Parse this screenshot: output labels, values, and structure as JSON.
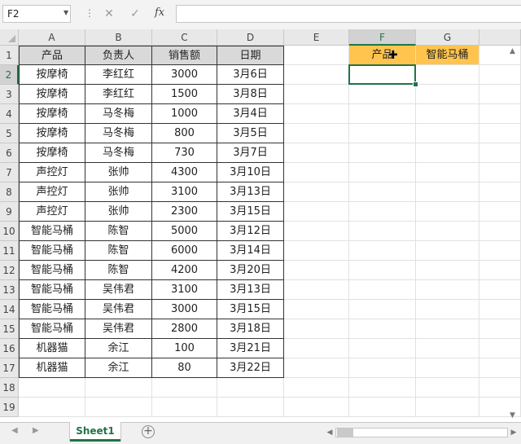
{
  "formula_bar": {
    "name_box": "F2",
    "cancel_icon": "✕",
    "enter_icon": "✓",
    "fx_label": "fx",
    "formula_value": ""
  },
  "columns": [
    "A",
    "B",
    "C",
    "D",
    "E",
    "F",
    "G"
  ],
  "selected_column": "F",
  "selected_row": 2,
  "rows": [
    {
      "row": "1",
      "cells": [
        "产品",
        "负责人",
        "销售额",
        "日期",
        "",
        "产品",
        "智能马桶"
      ]
    },
    {
      "row": "2",
      "cells": [
        "按摩椅",
        "李红红",
        "3000",
        "3月6日",
        "",
        "",
        ""
      ]
    },
    {
      "row": "3",
      "cells": [
        "按摩椅",
        "李红红",
        "1500",
        "3月8日",
        "",
        "",
        ""
      ]
    },
    {
      "row": "4",
      "cells": [
        "按摩椅",
        "马冬梅",
        "1000",
        "3月4日",
        "",
        "",
        ""
      ]
    },
    {
      "row": "5",
      "cells": [
        "按摩椅",
        "马冬梅",
        "800",
        "3月5日",
        "",
        "",
        ""
      ]
    },
    {
      "row": "6",
      "cells": [
        "按摩椅",
        "马冬梅",
        "730",
        "3月7日",
        "",
        "",
        ""
      ]
    },
    {
      "row": "7",
      "cells": [
        "声控灯",
        "张帅",
        "4300",
        "3月10日",
        "",
        "",
        ""
      ]
    },
    {
      "row": "8",
      "cells": [
        "声控灯",
        "张帅",
        "3100",
        "3月13日",
        "",
        "",
        ""
      ]
    },
    {
      "row": "9",
      "cells": [
        "声控灯",
        "张帅",
        "2300",
        "3月15日",
        "",
        "",
        ""
      ]
    },
    {
      "row": "10",
      "cells": [
        "智能马桶",
        "陈智",
        "5000",
        "3月12日",
        "",
        "",
        ""
      ]
    },
    {
      "row": "11",
      "cells": [
        "智能马桶",
        "陈智",
        "6000",
        "3月14日",
        "",
        "",
        ""
      ]
    },
    {
      "row": "12",
      "cells": [
        "智能马桶",
        "陈智",
        "4200",
        "3月20日",
        "",
        "",
        ""
      ]
    },
    {
      "row": "13",
      "cells": [
        "智能马桶",
        "吴伟君",
        "3100",
        "3月13日",
        "",
        "",
        ""
      ]
    },
    {
      "row": "14",
      "cells": [
        "智能马桶",
        "吴伟君",
        "3000",
        "3月15日",
        "",
        "",
        ""
      ]
    },
    {
      "row": "15",
      "cells": [
        "智能马桶",
        "吴伟君",
        "2800",
        "3月18日",
        "",
        "",
        ""
      ]
    },
    {
      "row": "16",
      "cells": [
        "机器猫",
        "余江",
        "100",
        "3月21日",
        "",
        "",
        ""
      ]
    },
    {
      "row": "17",
      "cells": [
        "机器猫",
        "余江",
        "80",
        "3月22日",
        "",
        "",
        ""
      ]
    },
    {
      "row": "18",
      "cells": [
        "",
        "",
        "",
        "",
        "",
        "",
        ""
      ]
    },
    {
      "row": "19",
      "cells": [
        "",
        "",
        "",
        "",
        "",
        "",
        ""
      ]
    }
  ],
  "sheet_tabs": [
    "Sheet1"
  ],
  "add_sheet_label": "+",
  "colors": {
    "accent": "#217346",
    "header_fill": "#d9d9d9",
    "criteria_fill": "#ffc44d"
  }
}
